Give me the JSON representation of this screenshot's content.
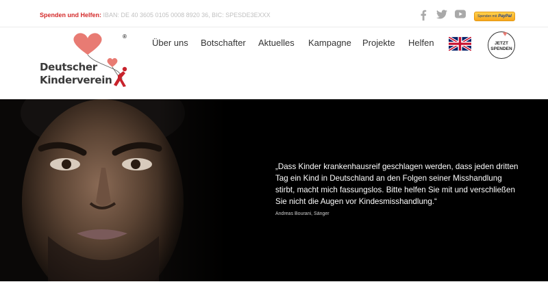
{
  "topbar": {
    "donate_label": "Spenden und Helfen:",
    "donate_details": "IBAN: DE 40 3605 0105 0008 8920 36, BIC: SPESDE3EXXX",
    "social": [
      "facebook-icon",
      "twitter-icon",
      "youtube-icon"
    ],
    "paypal_small": "Spenden mit",
    "paypal_brand": "PayPal"
  },
  "logo": {
    "line1": "Deutscher",
    "line2": "Kinderverein",
    "registered": "®"
  },
  "nav": {
    "items": [
      "Über uns",
      "Botschafter",
      "Aktuelles",
      "Kampagne",
      "Projekte",
      "Helfen"
    ]
  },
  "language": {
    "icon": "uk-flag-icon"
  },
  "donate_badge": {
    "line1": "JETZT",
    "line2": "SPENDEN"
  },
  "hero": {
    "quote": "„Dass Kinder krankenhausreif geschlagen werden, dass jeden dritten Tag ein Kind in Deutschland an den Folgen seiner Misshandlung stirbt, macht mich fassungslos. Bitte helfen Sie mit und verschließen Sie nicht die Augen vor Kindesmisshandlung.“",
    "author": "Andreas Bourani, Sänger"
  },
  "colors": {
    "accent": "#d42a2a",
    "heart": "#e87b73",
    "hero_bg": "#000000",
    "paypal": "#f7a51d"
  }
}
